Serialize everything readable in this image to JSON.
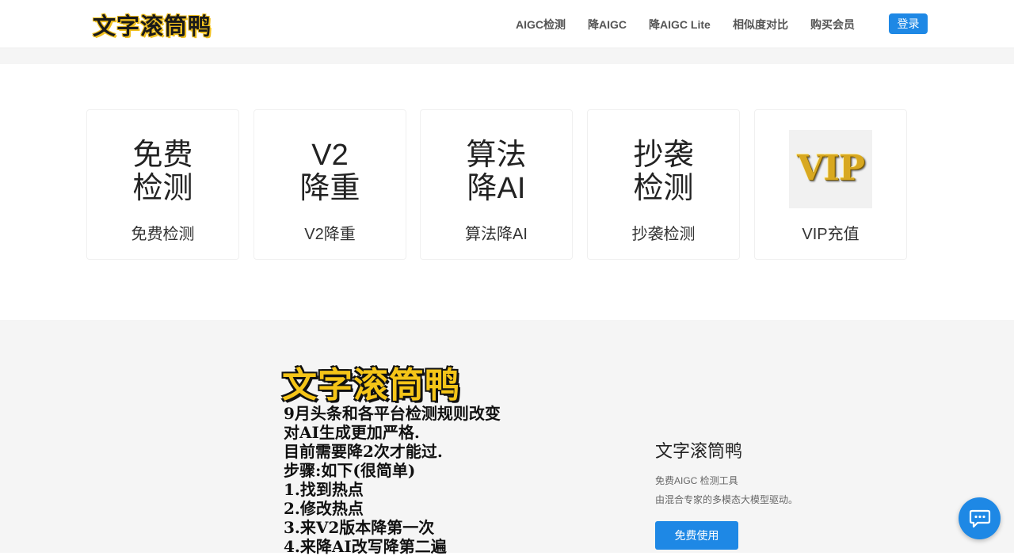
{
  "header": {
    "logo": "文字滚筒鸭",
    "nav": [
      "AIGC检测",
      "降AIGC",
      "降AIGC Lite",
      "相似度对比",
      "购买会员"
    ],
    "login": "登录"
  },
  "cards": [
    {
      "icon_text": "免费\n检测",
      "label": "免费检测"
    },
    {
      "icon_text": "V2\n降重",
      "label": "V2降重"
    },
    {
      "icon_text": "算法\n降AI",
      "label": "算法降AI"
    },
    {
      "icon_text": "抄袭\n检测",
      "label": "抄袭检测"
    },
    {
      "icon_text": "VIP",
      "label": "VIP充值"
    }
  ],
  "poster": {
    "title": "文字滚筒鸭",
    "lines": [
      "9月头条和各平台检测规则改变",
      "对AI生成更加严格.",
      "目前需要降2次才能过.",
      "步骤:如下(很简单)",
      "1.找到热点",
      "2.修改热点",
      "3.来V2版本降第一次",
      "4.来降AI改写降第二遍"
    ]
  },
  "promo": {
    "title": "文字滚筒鸭",
    "line1": "免费AIGC 检测工具",
    "line2": "由混合专家的多模态大模型驱动。",
    "button": "免费使用"
  },
  "colors": {
    "accent": "#1e88e5",
    "logo_yellow": "#f5c518",
    "section_bg": "#f5f5f5"
  },
  "icons": {
    "chat": "chat-bubble-icon"
  }
}
